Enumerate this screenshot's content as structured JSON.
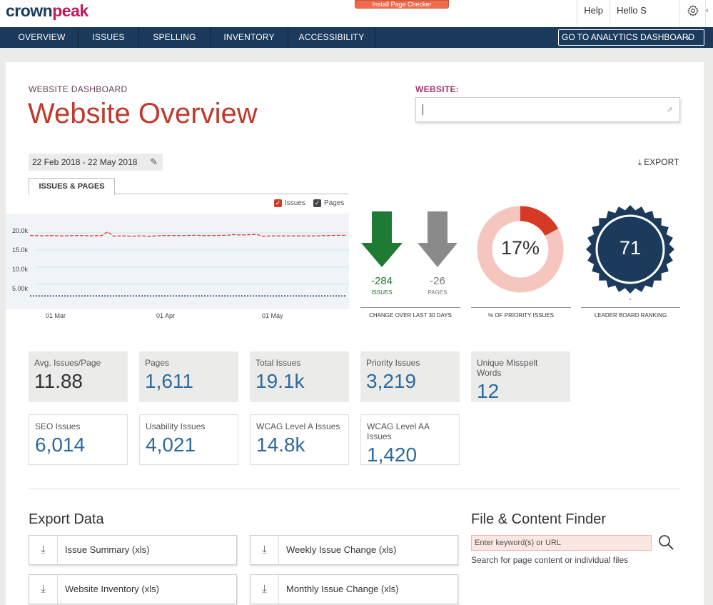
{
  "header": {
    "logo": {
      "part1": "crown",
      "part2": "peak"
    },
    "install_label": "Install Page Checker",
    "help_label": "Help",
    "hello_label": "Hello S"
  },
  "nav": {
    "items": [
      {
        "label": "OVERVIEW"
      },
      {
        "label": "ISSUES"
      },
      {
        "label": "SPELLING"
      },
      {
        "label": "INVENTORY"
      },
      {
        "label": "ACCESSIBILITY"
      }
    ],
    "cta_label": "GO TO ANALYTICS DASHBOARD",
    "cta_icon": "chevron-right-icon"
  },
  "page": {
    "eyebrow": "WEBSITE DASHBOARD",
    "title": "Website Overview",
    "website_label": "WEBSITE:",
    "website_value": ""
  },
  "toolbar": {
    "date_range": "22 Feb 2018 - 22 May 2018",
    "export_label": "EXPORT"
  },
  "tabs": [
    {
      "label": "ISSUES & PAGES"
    }
  ],
  "chart_data": {
    "type": "line",
    "legend": [
      {
        "name": "Issues",
        "color": "#d63a24",
        "checked": true
      },
      {
        "name": "Pages",
        "color": "#444444",
        "checked": true
      }
    ],
    "y_ticks": [
      "20.0k",
      "15.0k",
      "10.0k",
      "5.00k"
    ],
    "x_ticks": [
      "01 Mar",
      "01 Apr",
      "01 May"
    ],
    "ylim": [
      0,
      21000
    ],
    "series": [
      {
        "name": "Issues",
        "color": "#d63a24",
        "dash": true,
        "values": [
          19200,
          19200,
          19100,
          19200,
          19200,
          19100,
          19100,
          19200,
          19200,
          19200,
          19100,
          19200,
          19200,
          20300,
          19000,
          19100,
          19100,
          19000,
          19100,
          19100,
          19000,
          19100,
          19200,
          19200,
          19200,
          19200,
          19200,
          19300,
          19300,
          19200,
          19200,
          19200,
          19300,
          19300,
          19500,
          19400,
          19400,
          19500,
          19500,
          19000,
          19100,
          19100,
          19100,
          19100,
          19100,
          19100,
          19100,
          19100,
          19100,
          19200,
          19200,
          19300,
          19300,
          19300
        ]
      },
      {
        "name": "Pages",
        "color": "#1b3a5c",
        "dash": true,
        "values": [
          1611,
          1611,
          1611,
          1611,
          1611,
          1611,
          1611,
          1611,
          1611,
          1611,
          1611,
          1611,
          1611,
          1611,
          1611,
          1611,
          1611,
          1611,
          1611,
          1611,
          1611,
          1611,
          1611,
          1611,
          1611,
          1611,
          1611,
          1611,
          1611,
          1611,
          1611,
          1611,
          1611,
          1611,
          1611,
          1611,
          1611,
          1611,
          1611,
          1611,
          1611,
          1611,
          1611,
          1611,
          1611,
          1611,
          1611,
          1611,
          1611,
          1611,
          1611,
          1611,
          1611,
          1611
        ]
      }
    ]
  },
  "kpis": {
    "issues_change": {
      "value": "-284",
      "label": "ISSUES",
      "color": "#1f7a34"
    },
    "pages_change": {
      "value": "-26",
      "label": "PAGES",
      "color": "#8a8a8a"
    },
    "change_caption": "CHANGE OVER LAST 30 DAYS",
    "priority_pct": {
      "value": "17%",
      "fraction": 0.17,
      "caption": "% OF PRIORITY ISSUES",
      "ring_color": "#f4c6bd",
      "fill_color": "#d63a24"
    },
    "leaderboard": {
      "value": "71",
      "caption": "LEADER BOARD RANKING",
      "color": "#1b3a5c",
      "sub": "-"
    }
  },
  "stats_row1": [
    {
      "label": "Avg. Issues/Page",
      "value": "11.88"
    },
    {
      "label": "Pages",
      "value": "1,611"
    },
    {
      "label": "Total Issues",
      "value": "19.1k"
    },
    {
      "label": "Priority Issues",
      "value": "3,219"
    },
    {
      "label": "Unique Misspelt Words",
      "value": "12"
    }
  ],
  "stats_row2": [
    {
      "label": "SEO Issues",
      "value": "6,014"
    },
    {
      "label": "Usability Issues",
      "value": "4,021"
    },
    {
      "label": "WCAG Level A Issues",
      "value": "14.8k"
    },
    {
      "label": "WCAG Level AA Issues",
      "value": "1,420"
    }
  ],
  "export_data": {
    "title": "Export Data",
    "items": [
      {
        "label": "Issue Summary (xls)"
      },
      {
        "label": "Weekly Issue Change (xls)"
      },
      {
        "label": "Website Inventory (xls)"
      },
      {
        "label": "Monthly Issue Change (xls)"
      }
    ]
  },
  "finder": {
    "title": "File & Content Finder",
    "placeholder": "Enter keyword(s) or URL",
    "hint": "Search for page content or individual files"
  }
}
